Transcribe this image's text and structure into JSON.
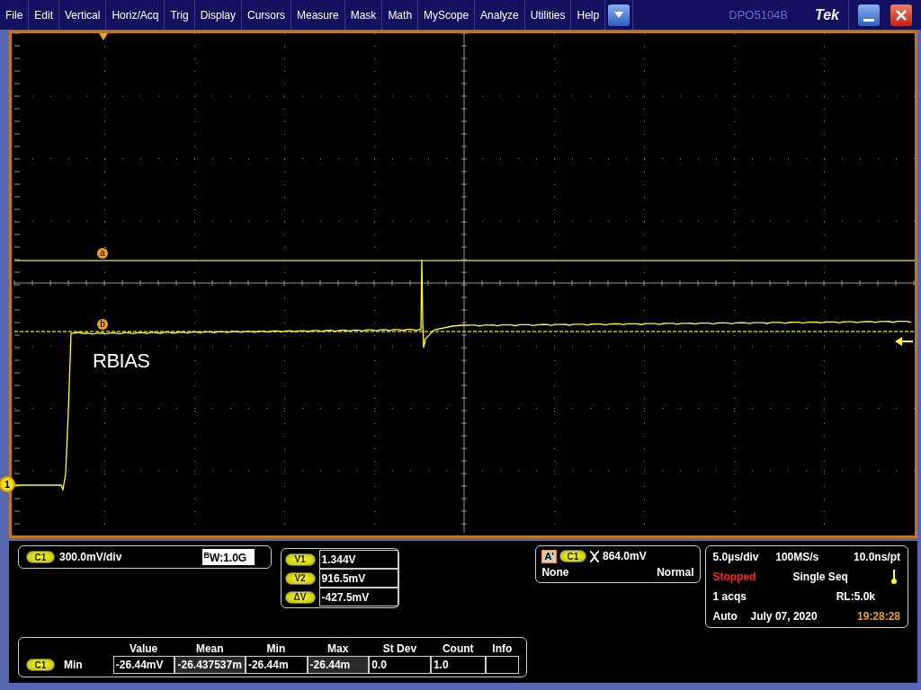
{
  "menu": {
    "items": [
      "File",
      "Edit",
      "Vertical",
      "Horiz/Acq",
      "Trig",
      "Display",
      "Cursors",
      "Measure",
      "Mask",
      "Math",
      "MyScope",
      "Analyze",
      "Utilities",
      "Help"
    ],
    "model": "DPO5104B",
    "brand": "Tek"
  },
  "graticule": {
    "cursors": [
      {
        "label": "a",
        "kind": "solid"
      },
      {
        "label": "b",
        "kind": "dashed"
      }
    ],
    "channel_marker": "1",
    "annotation": "RBIAS"
  },
  "channel": {
    "badge": "C1",
    "scale": "300.0mV/div",
    "bandwidth": "$^{B}$W:1.0G"
  },
  "cursor_readouts": [
    {
      "badge": "V1",
      "value": "1.344V"
    },
    {
      "badge": "V2",
      "value": "916.5mV"
    },
    {
      "badge": "ΔV",
      "value": "-427.5mV"
    }
  ],
  "trigger": {
    "mode_badge": "A'",
    "source": "C1",
    "level": "864.0mV",
    "coupling": "None",
    "type": "Normal"
  },
  "acquisition": {
    "time_scale": "5.0µs/div",
    "sample_rate": "100MS/s",
    "resolution": "10.0ns/pt",
    "state": "Stopped",
    "mode": "Single Seq",
    "count": "1 acqs",
    "record_length": "RL:5.0k",
    "trigger_mode": "Auto",
    "date": "July 07, 2020",
    "time": "19:28:28"
  },
  "measurements": {
    "columns": [
      "Value",
      "Mean",
      "Min",
      "Max",
      "St Dev",
      "Count",
      "Info"
    ],
    "rows": [
      {
        "source": "C1",
        "type": "Min",
        "cells": [
          "-26.44mV",
          "-26.437537m",
          "-26.44m",
          "-26.44m",
          "0.0",
          "1.0"
        ]
      }
    ]
  }
}
